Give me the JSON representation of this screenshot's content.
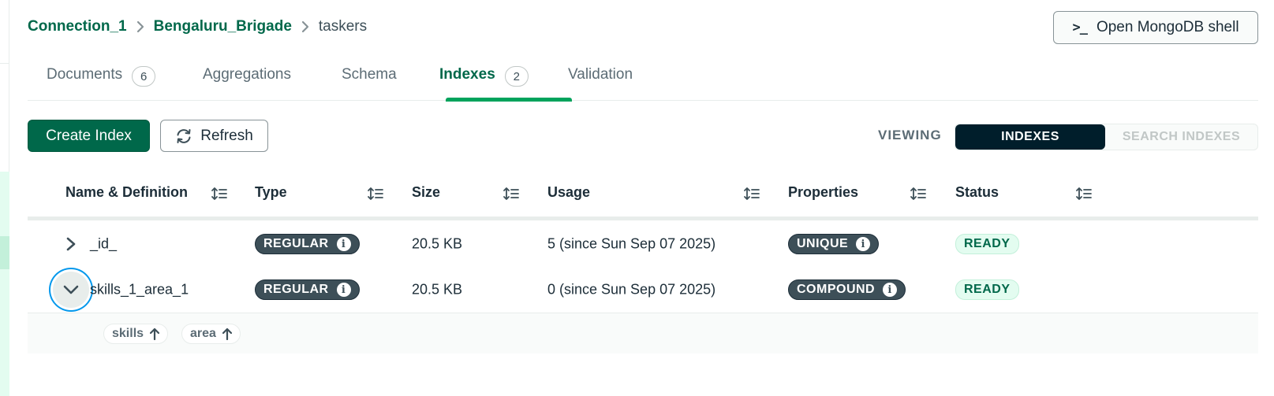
{
  "breadcrumb": {
    "connection": "Connection_1",
    "database": "Bengaluru_Brigade",
    "collection": "taskers"
  },
  "header": {
    "shell_button_label": "Open MongoDB shell",
    "shell_prompt_glyph": ">_"
  },
  "tabs": [
    {
      "label": "Documents",
      "count": "6"
    },
    {
      "label": "Aggregations"
    },
    {
      "label": "Schema"
    },
    {
      "label": "Indexes",
      "count": "2",
      "active": true
    },
    {
      "label": "Validation"
    }
  ],
  "toolbar": {
    "create_label": "Create Index",
    "refresh_label": "Refresh",
    "viewing_label": "VIEWING",
    "view_options": [
      "INDEXES",
      "SEARCH INDEXES"
    ],
    "selected_view": "INDEXES"
  },
  "table": {
    "columns": [
      "Name & Definition",
      "Type",
      "Size",
      "Usage",
      "Properties",
      "Status"
    ],
    "rows": [
      {
        "name": "_id_",
        "type": "REGULAR",
        "size": "20.5 KB",
        "usage": "5 (since Sun Sep 07 2025)",
        "property": "UNIQUE",
        "status": "READY",
        "expanded": false
      },
      {
        "name": "skills_1_area_1",
        "type": "REGULAR",
        "size": "20.5 KB",
        "usage": "0 (since Sun Sep 07 2025)",
        "property": "COMPOUND",
        "status": "READY",
        "expanded": true,
        "keys": [
          "skills",
          "area"
        ]
      }
    ]
  },
  "colors": {
    "brand_green": "#00684a",
    "accent_green": "#00a35c",
    "dark_navy": "#001e2b",
    "badge_gray": "#3d4f58",
    "ready_bg": "#e3fcf0",
    "focus_blue": "#0498ec"
  }
}
